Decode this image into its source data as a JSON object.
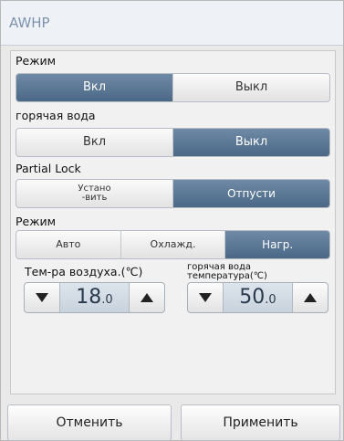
{
  "window": {
    "title": "AWHP"
  },
  "mode": {
    "label": "Режим",
    "options": [
      "Вкл",
      "Выкл"
    ],
    "selected": "Вкл"
  },
  "hot_water": {
    "label": "горячая вода",
    "options": [
      "Вкл",
      "Выкл"
    ],
    "selected": "Выкл"
  },
  "partial_lock": {
    "label": "Partial Lock",
    "options": [
      "Устано\n-вить",
      "Отпусти"
    ],
    "option_1_line1": "Устано",
    "option_1_line2": "-вить",
    "selected": "Отпусти"
  },
  "operation_mode": {
    "label": "Режим",
    "options": [
      "Авто",
      "Охлажд.",
      "Нагр."
    ],
    "selected": "Нагр."
  },
  "air_temp": {
    "label": "Тем-ра воздуха.(℃)",
    "value_int": "18",
    "value_dec": ".0"
  },
  "water_temp": {
    "label_line1": "горячая вода",
    "label_line2": "температура(℃)",
    "value_int": "50",
    "value_dec": ".0"
  },
  "footer": {
    "cancel_label": "Отменить",
    "apply_label": "Применить"
  },
  "colors": {
    "active": "#4f6d8b",
    "title_text": "#7f93ad"
  }
}
